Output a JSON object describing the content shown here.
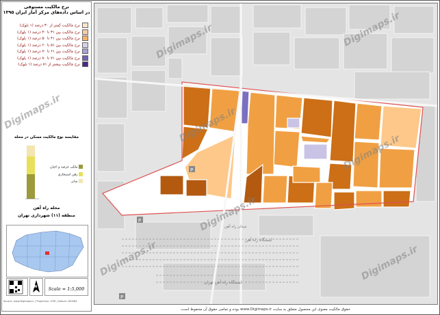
{
  "legend": {
    "title_line1": "نرخ مالکیت مستوفی",
    "title_line2": "در اساس داده‌های مرکز آمار ایران ۱۳۹۵",
    "items": [
      {
        "label": "نرخ مالکیت کمتر از ۳۰ درصد (۱ بلوک)",
        "color": "#fce5cd"
      },
      {
        "label": "نرخ مالکیت بین ۳۱ تا ۴۰ درصد (۱ بلوک)",
        "color": "#f5cba7"
      },
      {
        "label": "نرخ مالکیت بین ۴۱ تا ۵۰ درصد (۱ بلوک)",
        "color": "#f8b26a"
      },
      {
        "label": "نرخ مالکیت بین ۵۱ تا ۶۰ درصد (۱ بلوک)",
        "color": "#d8d3ea"
      },
      {
        "label": "نرخ مالکیت بین ۶۱ تا ۷۰ درصد (۱ بلوک)",
        "color": "#a99fd1"
      },
      {
        "label": "نرخ مالکیت بین ۷۱ تا ۸۰ درصد (۱ بلوک)",
        "color": "#6f63b0"
      },
      {
        "label": "نرخ مالکیت بیشتر از ۸۱ درصد (۱ بلوک)",
        "color": "#4b2a85"
      }
    ]
  },
  "bar_section": {
    "title": "مقایسه نوع مالکیت مسکن در محله",
    "items": [
      {
        "label": "ملکی عرصه و اعیان",
        "color": "#9c9a3a"
      },
      {
        "label": "رهن استیجاری",
        "color": "#e8e05a"
      },
      {
        "label": "سایر",
        "color": "#f3e6b0"
      }
    ]
  },
  "location": {
    "title": "محله راه آهن",
    "subtitle": "منطقه (۱۱) شهرداری تهران"
  },
  "scale": {
    "text": "Scale = 1:5,000",
    "north": "N"
  },
  "credits": "Source: www.Digimaps.ir | Projection: UTM | Datum: WGS84",
  "watermark": "Digimaps.ir",
  "map_labels": {
    "station": "ایستگاه راه آهن",
    "station2": "ایستگاه راه آهن تهران",
    "square": "میدان راه آهن"
  },
  "footer": "حقوق مالکیت معنوی این محصول متعلق به سایت www.Digimaps.ir بوده و تمامی حقوق آن محفوظ است.",
  "colors": {
    "orange_light": "#fdc889",
    "orange_mid": "#f0a043",
    "orange_dark": "#cc6f17",
    "brown": "#b35a10",
    "purple": "#7a6fc0",
    "lavender": "#c9c3e6",
    "boundary": "#e05050"
  }
}
